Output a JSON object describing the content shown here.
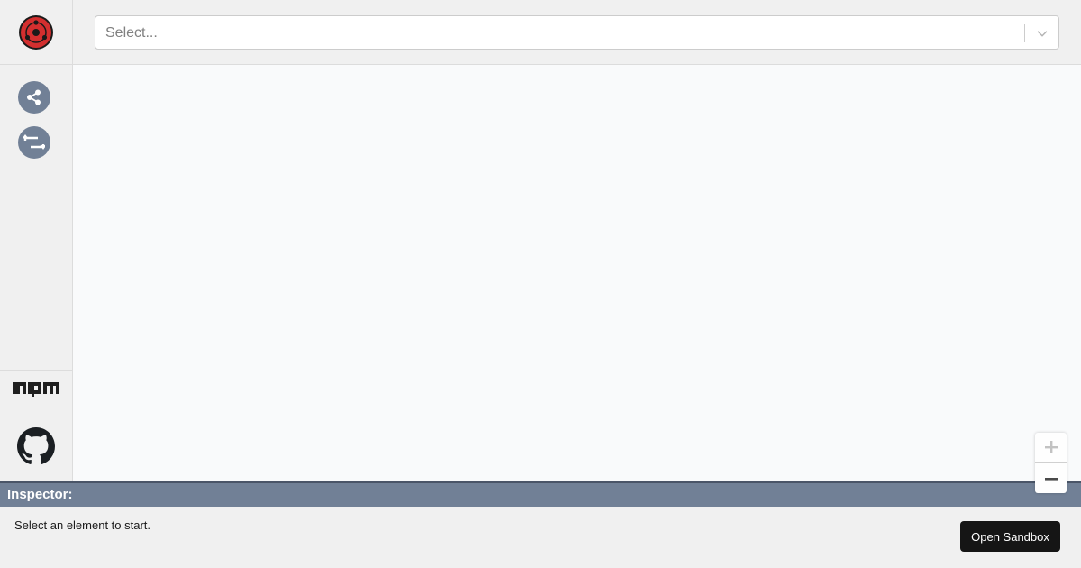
{
  "select": {
    "placeholder": "Select..."
  },
  "inspector": {
    "title": "Inspector:",
    "message": "Select an element to start."
  },
  "actions": {
    "open_sandbox": "Open Sandbox"
  },
  "icons": {
    "logo": "sharingan-logo-icon",
    "share": "share-icon",
    "swap": "swap-icon",
    "npm": "npm-icon",
    "github": "github-icon",
    "zoom_in": "plus-icon",
    "zoom_out": "minus-icon",
    "dropdown": "chevron-down-icon"
  },
  "colors": {
    "accent_gray": "#718096",
    "logo_red": "#d32f2f",
    "sandbox_button": "#151515",
    "canvas": "#f9fafb"
  }
}
